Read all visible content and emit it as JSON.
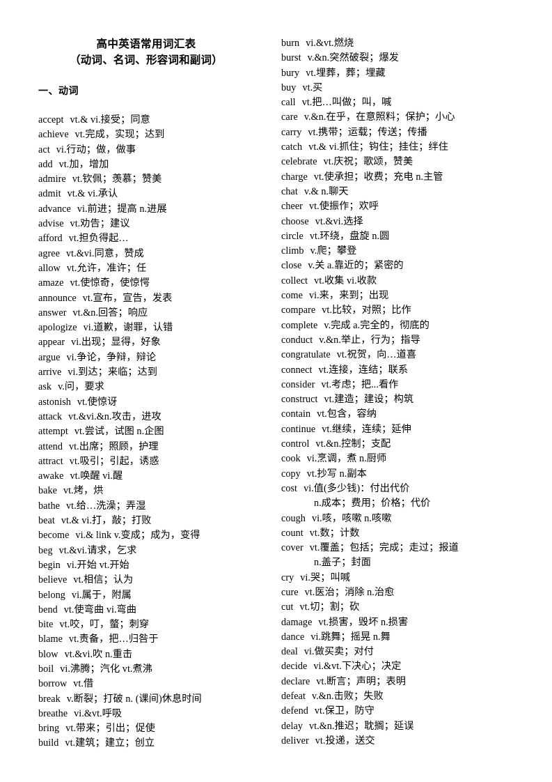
{
  "document": {
    "title": "高中英语常用词汇表",
    "subtitle": "（动词、名词、形容词和副词）",
    "section_heading": "一、动词"
  },
  "columns": {
    "left": [
      {
        "word": "accept",
        "sense": "vt.& vi.接受；同意"
      },
      {
        "word": "achieve",
        "sense": "vt.完成，实现；达到"
      },
      {
        "word": "act",
        "sense": "vi.行动；做，做事"
      },
      {
        "word": "add",
        "sense": "vt.加，增加"
      },
      {
        "word": "admire",
        "sense": "vt.钦佩；羡慕；赞美"
      },
      {
        "word": "admit",
        "sense": "vt.& vi.承认"
      },
      {
        "word": "advance",
        "sense": "vi.前进；提高 n.进展"
      },
      {
        "word": "advise",
        "sense": "vt.劝告；建议"
      },
      {
        "word": "afford",
        "sense": "vt.担负得起…"
      },
      {
        "word": "agree",
        "sense": "vt.&vi.同意，赞成"
      },
      {
        "word": "allow",
        "sense": "vt.允许，准许；任"
      },
      {
        "word": "amaze",
        "sense": "vt.使惊奇，使惊愕"
      },
      {
        "word": "announce",
        "sense": "vt.宣布，宣告，发表"
      },
      {
        "word": "answer",
        "sense": "vt.&n.回答；响应"
      },
      {
        "word": "apologize",
        "sense": "vi.道歉，谢罪，认错"
      },
      {
        "word": "appear",
        "sense": "vi.出现；显得，好象"
      },
      {
        "word": "argue",
        "sense": "vi.争论，争辩，辩论"
      },
      {
        "word": "arrive",
        "sense": "vi.到达；来临；达到"
      },
      {
        "word": "ask",
        "sense": "v.问，要求"
      },
      {
        "word": "astonish",
        "sense": "vt.使惊讶"
      },
      {
        "word": "attack",
        "sense": "vt.&vi.&n.攻击，进攻"
      },
      {
        "word": "attempt",
        "sense": "vt.尝试，试图 n.企图"
      },
      {
        "word": "attend",
        "sense": "vt.出席；照顾，护理"
      },
      {
        "word": "attract",
        "sense": "vt.吸引；引起，诱惑"
      },
      {
        "word": "awake",
        "sense": "vt.唤醒 vi.醒"
      },
      {
        "word": "bake",
        "sense": "vt.烤，烘"
      },
      {
        "word": "bathe",
        "sense": "vt.给…洗澡；弄湿"
      },
      {
        "word": "beat",
        "sense": "vt.& vi.打，敲；打败"
      },
      {
        "word": "become",
        "sense": "vi.& link v.变成；成为，变得"
      },
      {
        "word": "beg",
        "sense": "vt.&vi.请求，乞求"
      },
      {
        "word": "begin",
        "sense": "vi.开始 vt.开始"
      },
      {
        "word": "believe",
        "sense": "vt.相信；认为"
      },
      {
        "word": "belong",
        "sense": "vi.属于，附属"
      },
      {
        "word": "bend",
        "sense": "vt.使弯曲 vi.弯曲"
      },
      {
        "word": "bite",
        "sense": "vt.咬，叮，螫；刺穿"
      },
      {
        "word": "blame",
        "sense": "vt.责备，把…归咎于"
      },
      {
        "word": "blow",
        "sense": "vt.&vi.吹 n.重击"
      },
      {
        "word": "boil",
        "sense": "vi.沸腾；汽化 vt.煮沸"
      },
      {
        "word": "borrow",
        "sense": "vt.借"
      },
      {
        "word": "break",
        "sense": "v.断裂；打破 n. (课间)休息时间"
      },
      {
        "word": "breathe",
        "sense": "vi.&vt.呼吸"
      },
      {
        "word": "bring",
        "sense": "vt.带来；引出；促使"
      },
      {
        "word": "build",
        "sense": "vt.建筑；建立；创立"
      }
    ],
    "right": [
      {
        "word": "burn",
        "sense": "vi.&vt.燃烧"
      },
      {
        "word": "burst",
        "sense": "v.&n.突然破裂；爆发"
      },
      {
        "word": "bury",
        "sense": "vt.埋葬，葬；埋藏"
      },
      {
        "word": "buy",
        "sense": "vt.买"
      },
      {
        "word": "call",
        "sense": "vt.把…叫做；叫，喊"
      },
      {
        "word": "care",
        "sense": "v.&n.在乎，在意照料；保护；小心"
      },
      {
        "word": "carry",
        "sense": "vt.携带；运载；传送；传播"
      },
      {
        "word": "catch",
        "sense": "vt.& vi.抓住；钩住；挂住；绊住"
      },
      {
        "word": "celebrate",
        "sense": "vt.庆祝；歌颂，赞美"
      },
      {
        "word": "charge",
        "sense": "vt.使承担；收费；充电 n.主管"
      },
      {
        "word": "chat",
        "sense": "v.& n.聊天"
      },
      {
        "word": "cheer",
        "sense": "vt.使振作；欢呼"
      },
      {
        "word": "choose",
        "sense": "vt.&vi.选择"
      },
      {
        "word": "circle",
        "sense": "vt.环绕，盘旋 n.圆"
      },
      {
        "word": "climb",
        "sense": "v.爬；攀登"
      },
      {
        "word": "close",
        "sense": "v.关 a.靠近的；紧密的"
      },
      {
        "word": "collect",
        "sense": "vt.收集 vi.收款"
      },
      {
        "word": "come",
        "sense": "vi.来，来到；出现"
      },
      {
        "word": "compare",
        "sense": "vt.比较，对照；比作"
      },
      {
        "word": "complete",
        "sense": "v.完成 a.完全的，彻底的"
      },
      {
        "word": "conduct",
        "sense": "v.&n.举止，行为；指导"
      },
      {
        "word": "congratulate",
        "sense": "vt.祝贺，向…道喜"
      },
      {
        "word": "connect",
        "sense": "vt.连接，连结；联系"
      },
      {
        "word": "consider",
        "sense": "vt.考虑；把...看作"
      },
      {
        "word": "construct",
        "sense": "vt.建造；建设；构筑"
      },
      {
        "word": "contain",
        "sense": "vt.包含，容纳"
      },
      {
        "word": "continue",
        "sense": "vt.继续，连续；延伸"
      },
      {
        "word": "control",
        "sense": "vt.&n.控制；支配"
      },
      {
        "word": "cook",
        "sense": "vi.烹调，煮 n.厨师"
      },
      {
        "word": "copy",
        "sense": "vt.抄写 n.副本"
      },
      {
        "word": "cost",
        "sense": "vi.值(多少钱)：付出代价"
      },
      {
        "word": "",
        "sense": "n.成本；费用；价格；代价",
        "continuation": true
      },
      {
        "word": "cough",
        "sense": "vi.咳，咳嗽 n.咳嗽"
      },
      {
        "word": "count",
        "sense": "vt.数；计数"
      },
      {
        "word": "cover",
        "sense": "vt.覆盖；包括；完成；走过；报道"
      },
      {
        "word": "",
        "sense": "n.盖子；封面",
        "continuation": true
      },
      {
        "word": "cry",
        "sense": "vi.哭；叫喊"
      },
      {
        "word": "cure",
        "sense": "vt.医治；消除 n.治愈"
      },
      {
        "word": "cut",
        "sense": "vt.切；割；砍"
      },
      {
        "word": "damage",
        "sense": "vt.损害，毁坏 n.损害"
      },
      {
        "word": "dance",
        "sense": "vi.跳舞；摇晃 n.舞"
      },
      {
        "word": "deal",
        "sense": "vi.做买卖；对付"
      },
      {
        "word": "decide",
        "sense": "vi.&vt.下决心；决定"
      },
      {
        "word": "declare",
        "sense": "vt.断言；声明；表明"
      },
      {
        "word": "defeat",
        "sense": "v.&n.击败；失败"
      },
      {
        "word": "defend",
        "sense": "vt.保卫，防守"
      },
      {
        "word": "delay",
        "sense": "vt.&n.推迟；耽搁；延误"
      },
      {
        "word": "deliver",
        "sense": "vt.投递，送交"
      }
    ]
  }
}
